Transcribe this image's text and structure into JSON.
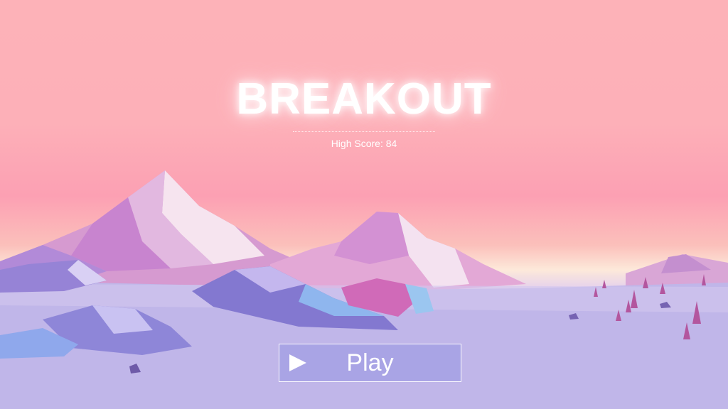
{
  "game": {
    "title": "BREAKOUT",
    "high_score_text": "High Score: 84"
  },
  "menu": {
    "play_label": "Play",
    "play_icon": "play-icon"
  },
  "colors": {
    "sky_top": "#fdb2b8",
    "horizon": "#fde9da",
    "ground": "#bcb3e8",
    "text": "#ffffff"
  }
}
